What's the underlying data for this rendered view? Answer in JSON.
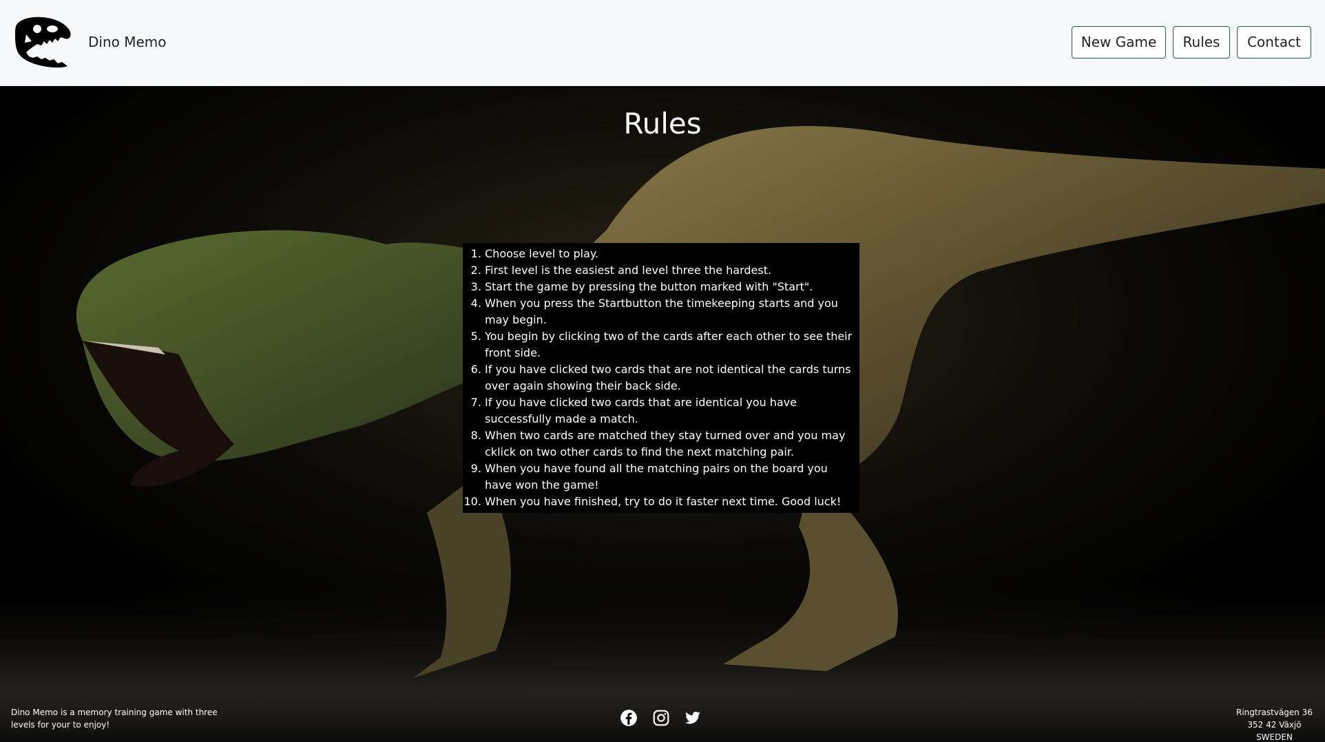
{
  "header": {
    "brand": "Dino Memo",
    "nav": {
      "new_game": "New Game",
      "rules": "Rules",
      "contact": "Contact"
    }
  },
  "main": {
    "title": "Rules",
    "rules": [
      "Choose level to play.",
      "First level is the easiest and level three the hardest.",
      "Start the game by pressing the button marked with \"Start\".",
      "When you press the Startbutton the timekeeping starts and you may begin.",
      "You begin by clicking two of the cards after each other to see their front side.",
      "If you have clicked two cards that are not identical the cards turns over again showing their back side.",
      "If you have clicked two cards that are identical you have successfully made a match.",
      "When two cards are matched they stay turned over and you may cklick on two other cards to find the next matching pair.",
      "When you have found all the matching pairs on the board you have won the game!",
      "When you have finished, try to do it faster next time. Good luck!"
    ]
  },
  "footer": {
    "about": "Dino Memo is a memory training game with three levels for your to enjoy!",
    "address": {
      "street": "Ringtrastvägen 36",
      "postal": "352 42 Växjö",
      "country": "SWEDEN"
    },
    "social_icons": [
      "facebook-icon",
      "instagram-icon",
      "twitter-icon"
    ]
  },
  "colors": {
    "header_bg": "#f8f9fa",
    "button_border": "#1f5f4e",
    "main_bg": "#000000",
    "text_light": "#ffffff"
  }
}
